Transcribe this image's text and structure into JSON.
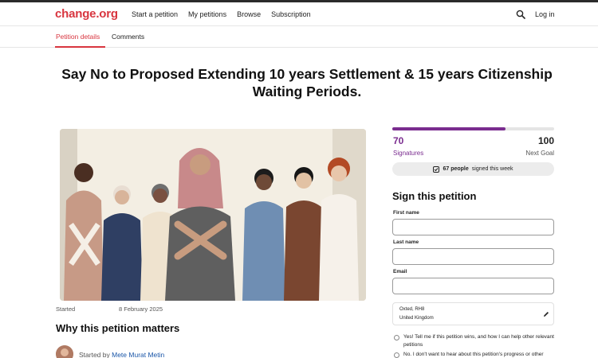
{
  "header": {
    "logo": "change.org",
    "nav": [
      "Start a petition",
      "My petitions",
      "Browse",
      "Subscription"
    ],
    "login": "Log in"
  },
  "tabs": {
    "details": "Petition details",
    "comments": "Comments"
  },
  "petition": {
    "title": "Say No to Proposed Extending 10 years Settlement & 15 years Citizenship Waiting Periods.",
    "started_label": "Started",
    "started_date": "8 February 2025",
    "why_heading": "Why this petition matters",
    "started_by_prefix": "Started by",
    "author": "Mete Murat Metin"
  },
  "signatures": {
    "count": "70",
    "count_label": "Signatures",
    "goal": "100",
    "goal_label": "Next Goal",
    "progress_fraction": 0.7,
    "week_count": "67 people",
    "week_text": "signed this week",
    "accent_color": "#7a2c8f"
  },
  "form": {
    "heading": "Sign this petition",
    "first_name_label": "First name",
    "last_name_label": "Last name",
    "email_label": "Email",
    "location_line1": "Oxted, RH8",
    "location_line2": "United Kingdom",
    "option_yes": "Yes! Tell me if this petition wins, and how I can help other relevant petitions",
    "option_no": "No. I don't want to hear about this petition's progress or other"
  },
  "colors": {
    "brand": "#d8353f",
    "link": "#1a56a8"
  }
}
